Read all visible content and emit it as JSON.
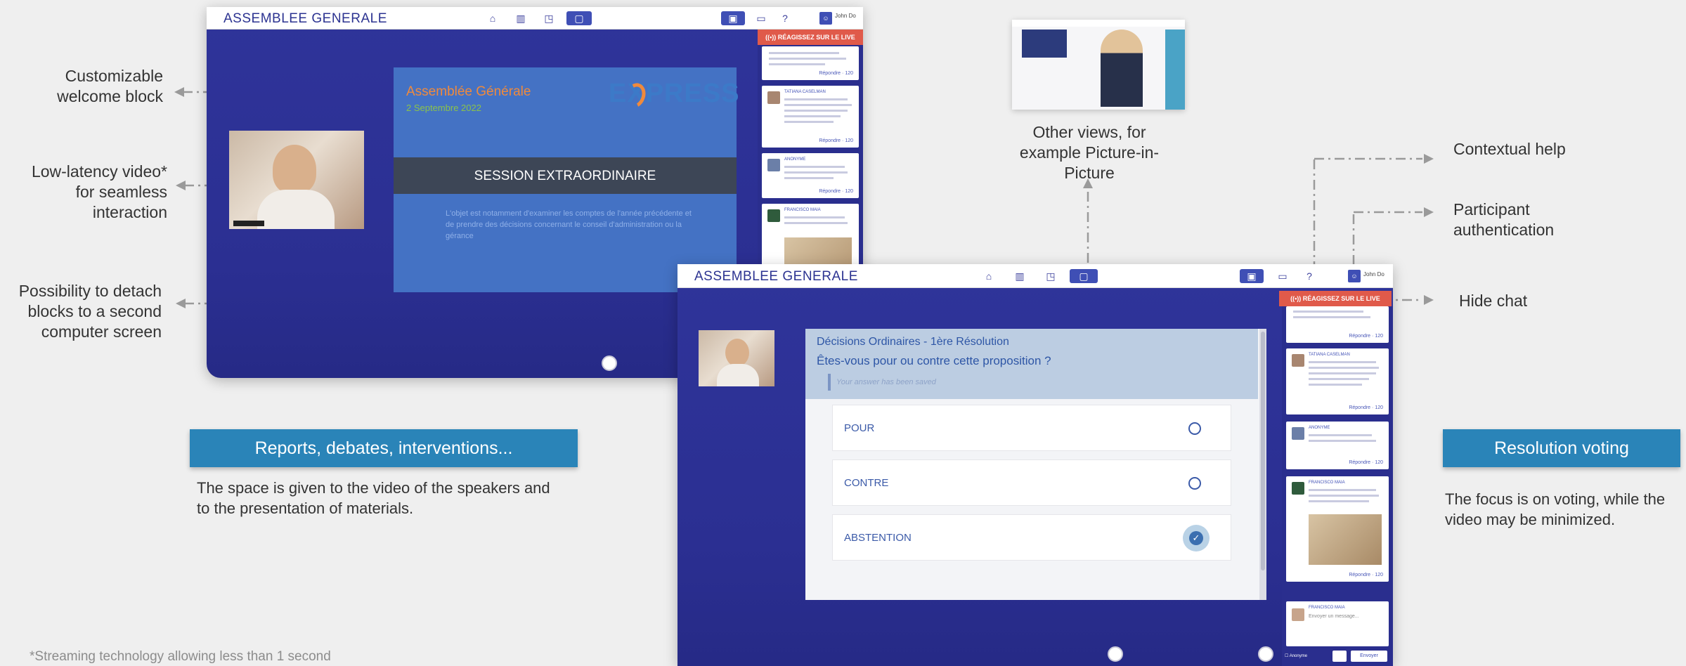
{
  "left_annotations": {
    "welcome_block": "Customizable welcome block",
    "video": "Low-latency video* for seamless interaction",
    "detach": "Possibility to detach blocks to a second computer screen"
  },
  "right_annotations": {
    "other_views": "Other views, for example Picture-in-Picture",
    "contextual_help": "Contextual help",
    "participant_auth": "Participant authentication",
    "hide_chat": "Hide chat"
  },
  "screen1": {
    "app_title": "ASSEMBLEE GENERALE",
    "user_name": "John Do",
    "live_label": "((•)) RÉAGISSEZ SUR LE LIVE",
    "slide": {
      "title": "Assemblée Générale",
      "date": "2 Septembre 2022",
      "logo_text": "EXPRESS",
      "session": "SESSION EXTRAORDINAIRE",
      "body": "L'objet est notamment d'examiner les comptes de l'année précédente et de prendre des décisions concernant le conseil d'administration ou la gérance"
    },
    "chat": [
      {
        "reply": "Répondre",
        "likes": "120"
      },
      {
        "name": "TATIANA CASELMAN",
        "reply": "Répondre",
        "likes": "120"
      },
      {
        "name": "ANONYME",
        "reply": "Répondre",
        "likes": "120"
      },
      {
        "name": "FRANCISCO MAIA",
        "reply": "Répondre",
        "likes": "120"
      }
    ]
  },
  "screen2": {
    "app_title": "ASSEMBLEE GENERALE",
    "user_name": "John Do",
    "live_label": "((•)) RÉAGISSEZ SUR LE LIVE",
    "resolution_title": "Décisions Ordinaires - 1ère Résolution",
    "question": "Êtes-vous pour ou contre cette proposition ?",
    "saved_note": "Your answer has been saved",
    "options": [
      "POUR",
      "CONTRE",
      "ABSTENTION"
    ],
    "selected_option": "ABSTENTION",
    "chat_footer_name": "FRANCISCO MAIA",
    "chat_placeholder": "Envoyer un message...",
    "anonymous_label": "Anonyme",
    "send_label": "Envoyer"
  },
  "banners": {
    "left": "Reports, debates, interventions...",
    "right": "Resolution voting"
  },
  "captions": {
    "left": "The space is given to the video of the speakers and to the presentation of materials.",
    "right": "The focus is on voting, while the video may be minimized."
  },
  "footnote": "*Streaming technology allowing less than 1 second",
  "colors": {
    "frame_bg": "#2f349a",
    "banner": "#2a84b8",
    "live_red": "#e05a4a",
    "slide_blue": "#4472c4"
  },
  "icons": [
    "home-icon",
    "split-view-icon",
    "pip-icon",
    "fullscreen-icon",
    "chat-toggle-icon",
    "monitor-icon",
    "help-icon",
    "user-icon"
  ]
}
